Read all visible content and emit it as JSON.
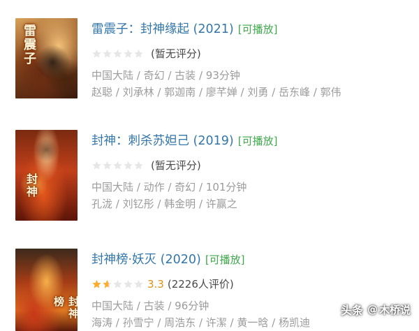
{
  "items": [
    {
      "poster_title": "雷震子",
      "title": "雷震子：封神缘起 (2021)",
      "playable": "[可播放]",
      "rating_fraction": 0,
      "score": "",
      "rating_text": "(暂无评分)",
      "genres": "中国大陆 / 奇幻 / 古装 / 93分钟",
      "cast": "赵聪 / 刘承林 / 郭迦南 / 廖芊婵 / 刘勇 / 岳东峰 / 郭伟"
    },
    {
      "poster_title": "封神",
      "title": "封神：刺杀苏妲己 (2019)",
      "playable": "[可播放]",
      "rating_fraction": 0,
      "score": "",
      "rating_text": "(暂无评分)",
      "genres": "中国大陆 / 动作 / 奇幻 / 101分钟",
      "cast": "孔泷 / 刘钇彤 / 韩金明 / 许赢之"
    },
    {
      "poster_title": "封神榜",
      "title": "封神榜·妖灭 (2020)",
      "playable": "[可播放]",
      "rating_fraction": 0.33,
      "score": "3.3",
      "rating_text": "(2226人评价)",
      "genres": "中国大陆 / 古装 / 96分钟",
      "cast": "海涛 / 孙雪宁 / 周浩东 / 许潔 / 黄一晗 / 杨凯迪"
    }
  ],
  "watermark": {
    "logo_text": "头条",
    "at": "@",
    "name": "木桥说"
  },
  "colors": {
    "title": "#3377aa",
    "playable": "#3fa84c",
    "meta": "#9b9b9b",
    "star_on": "#ffac2d",
    "star_off": "#e6e6e6",
    "score": "#e09015"
  }
}
